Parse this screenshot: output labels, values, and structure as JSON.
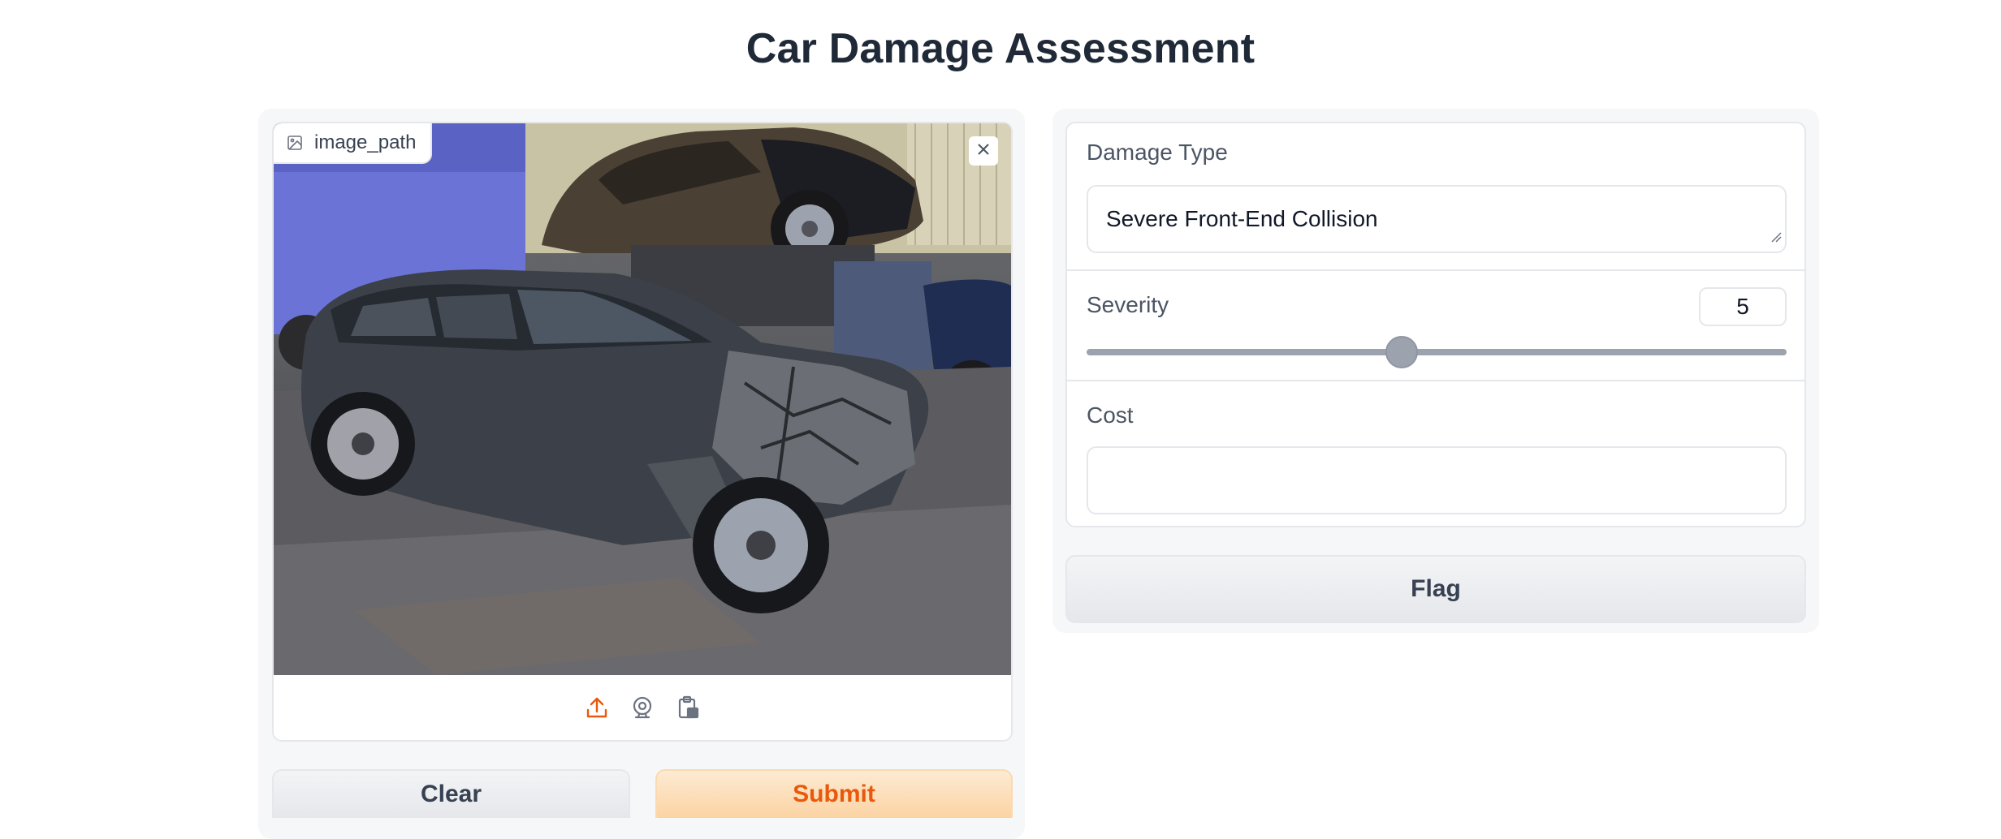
{
  "page": {
    "title": "Car Damage Assessment"
  },
  "image_input": {
    "label": "image_path",
    "label_icon": "image-icon",
    "clear_icon": "close-icon",
    "sources": [
      {
        "name": "upload-icon",
        "color": "#ea580c"
      },
      {
        "name": "webcam-icon",
        "color": "#6b7280"
      },
      {
        "name": "clipboard-icon",
        "color": "#6b7280"
      }
    ]
  },
  "buttons": {
    "clear": "Clear",
    "submit": "Submit",
    "flag": "Flag"
  },
  "outputs": {
    "damage_type": {
      "label": "Damage Type",
      "value": "Severe Front-End Collision"
    },
    "severity": {
      "label": "Severity",
      "value": "5",
      "fraction": 0.45
    },
    "cost": {
      "label": "Cost",
      "value": ""
    }
  },
  "colors": {
    "accent": "#ea580c",
    "submit_bg": "#fbd3a3",
    "slider": "#9ca3af",
    "panel_bg": "#f6f7f9",
    "border": "#e5e7eb"
  }
}
